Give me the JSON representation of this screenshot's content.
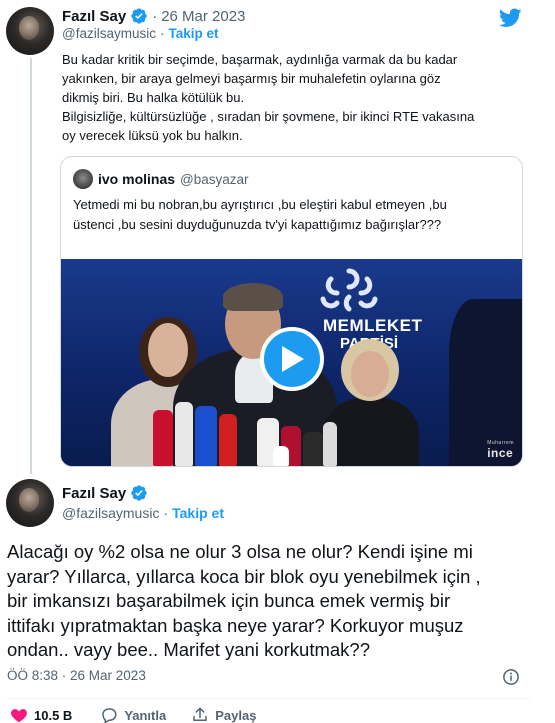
{
  "tweet1": {
    "name": "Fazıl Say",
    "handle": "@fazilsaymusic",
    "separator": "·",
    "date": "26 Mar 2023",
    "follow": "Takip et",
    "lines": [
      "Bu kadar kritik bir seçimde, başarmak, aydınlığa varmak da bu kadar",
      "yakınken, bir araya gelmeyi başarmış bir muhalefetin oylarına göz",
      "dikmiş biri. Bu halka kötülük bu.",
      "Bilgisizliğe, kültürsüzlüğe , sıradan bir şovmene, bir ikinci RTE vakasına",
      "oy verecek lüksü yok bu halkın."
    ]
  },
  "quote": {
    "name": "ivo molinas",
    "handle": "@basyazar",
    "lines": [
      "Yetmedi mi bu nobran,bu ayrıştırıcı ,bu eleştiri kabul etmeyen ,bu",
      "üstenci ,bu sesini duyduğunuzda tv'yi kapattığımız bağırışlar???"
    ],
    "video": {
      "backdrop_line1": "MEMLEKET",
      "backdrop_line2": "PARTİSİ",
      "watermark": "ince",
      "watermark_small": "Muharrem"
    }
  },
  "tweet2": {
    "name": "Fazıl Say",
    "handle": "@fazilsaymusic",
    "separator": "·",
    "follow": "Takip et",
    "lines": [
      "Alacağı oy %2 olsa ne olur 3 olsa ne olur? Kendi işine mi",
      "yarar?  Yıllarca, yıllarca koca bir blok oyu yenebilmek için ,",
      "bir imkansızı başarabilmek için bunca emek vermiş bir",
      "ittifakı yıpratmaktan başka neye yarar? Korkuyor muşuz",
      "ondan.. vayy bee.. Marifet yani korkutmak??"
    ],
    "timestamp": "ÖÖ 8:38 · 26 Mar 2023"
  },
  "actions": {
    "likes": "10.5 B",
    "reply": "Yanıtla",
    "share": "Paylaş"
  },
  "colors": {
    "brand": "#1d9bf0",
    "like": "#f91880",
    "muted": "#536471",
    "border": "#cfd9de"
  },
  "icons": [
    "verified-badge-icon",
    "twitter-bird-icon",
    "play-icon",
    "info-icon",
    "heart-icon",
    "reply-icon",
    "share-icon"
  ]
}
